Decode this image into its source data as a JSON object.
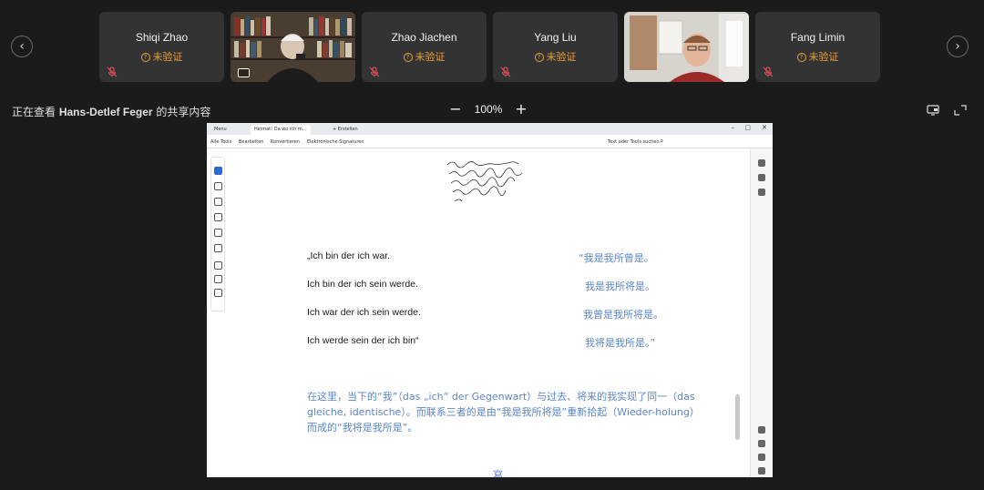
{
  "participants": [
    {
      "name": "Shiqi Zhao",
      "status": "未验证",
      "type": "avatar"
    },
    {
      "name": "",
      "status": "",
      "type": "video"
    },
    {
      "name": "Zhao Jiachen",
      "status": "未验证",
      "type": "avatar"
    },
    {
      "name": "Yang Liu",
      "status": "未验证",
      "type": "avatar"
    },
    {
      "name": "",
      "status": "",
      "type": "video"
    },
    {
      "name": "Fang Limin",
      "status": "未验证",
      "type": "avatar"
    }
  ],
  "share": {
    "prefix": "正在查看",
    "presenter": "Hans-Detlef Feger",
    "suffix": "的共享内容",
    "zoom": "100%",
    "zoom_out": "−",
    "zoom_in": "+"
  },
  "doc_window": {
    "tabs": [
      "Menu",
      "Heimat! Da wo ich m...",
      "+ Erstellen"
    ],
    "toolbar_menus": [
      "Alle Tools",
      "Bearbeiten",
      "Konvertieren",
      "Elektronische Signaturen"
    ],
    "search_placeholder": "Text oder Tools suchen"
  },
  "document": {
    "german_lines": [
      "„Ich bin der ich war.",
      "Ich bin der ich sein werde.",
      "Ich war der ich sein werde.",
      "Ich werde sein der ich bin“"
    ],
    "chinese_lines": [
      "“我是我所曾是。",
      "我是我所将是。",
      "我曾是我所将是。",
      "我将是我所是。”"
    ],
    "paragraph": "在这里，当下的“我”（das „ich“ der Gegenwart）与过去、将来的我实现了同一（das gleiche, identische）。而联系三者的是由“我是我所将是”重新拾起（Wieder-holung）而成的“我将是我所是”。",
    "page_end": "寫"
  },
  "colors": {
    "background": "#1b1b1b",
    "tile": "#333333",
    "unverified": "#e6a23c",
    "chinese_text": "#5a86c8"
  }
}
